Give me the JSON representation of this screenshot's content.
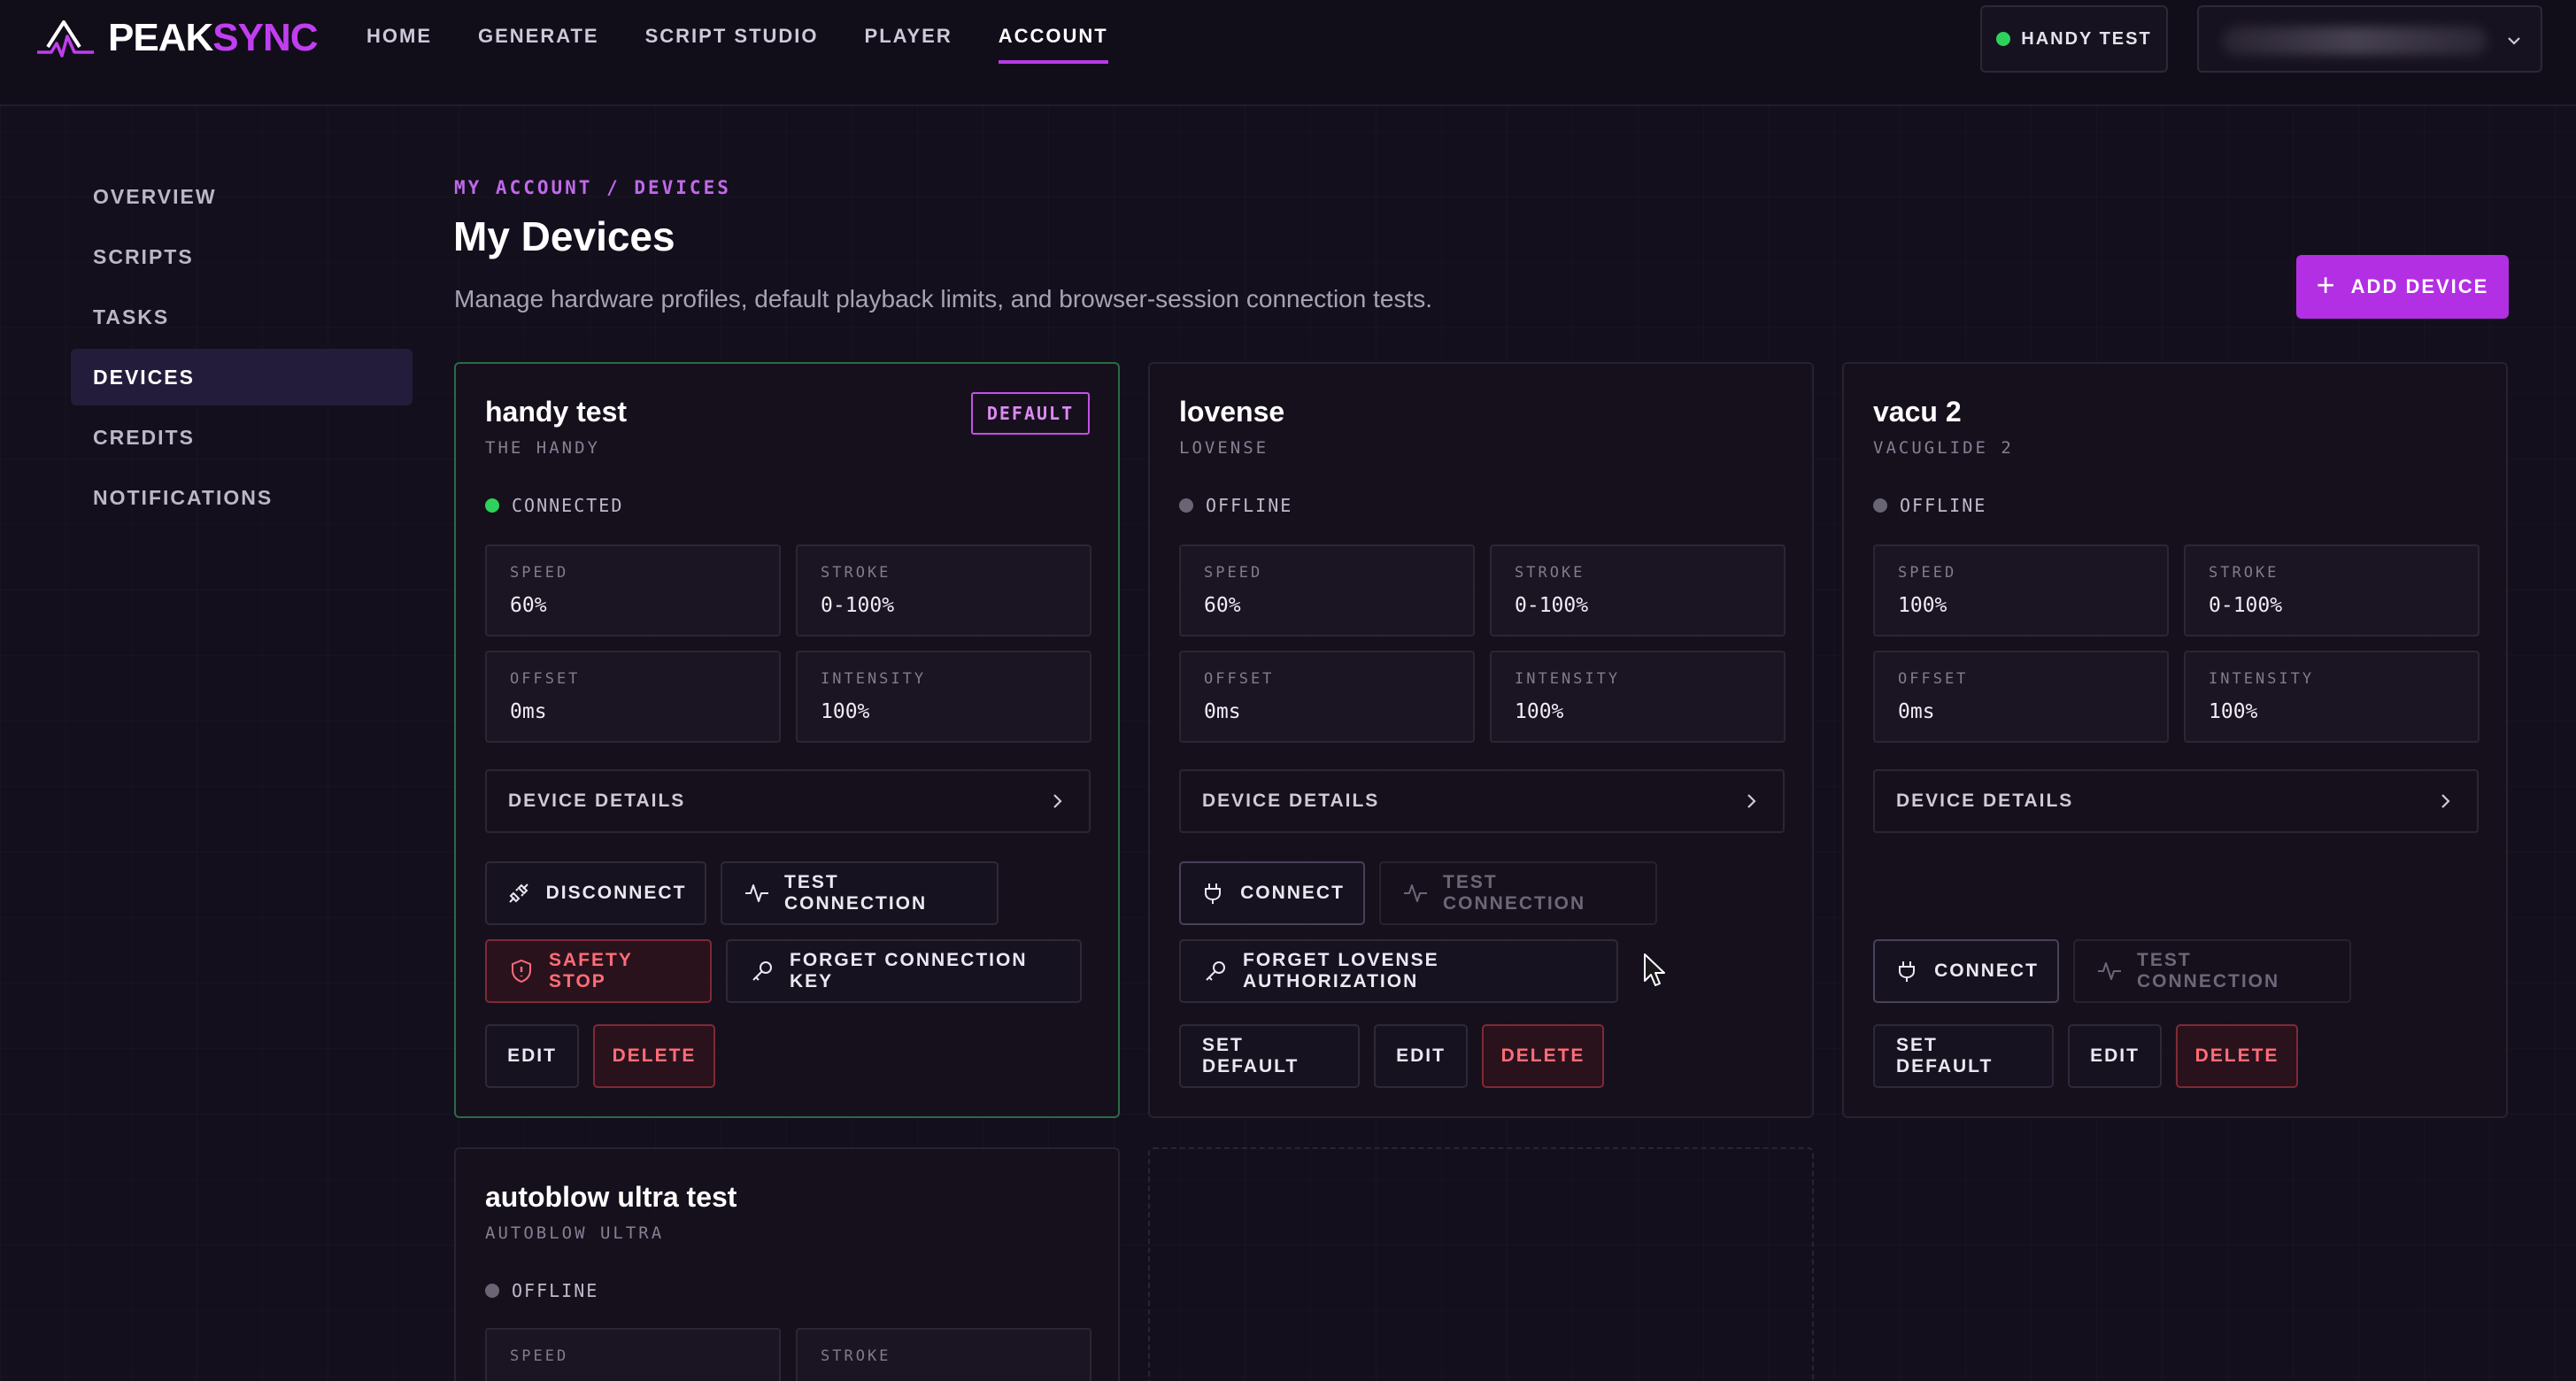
{
  "brand": {
    "peak": "PEAK",
    "sync": "SYNC"
  },
  "nav": [
    "HOME",
    "GENERATE",
    "SCRIPT STUDIO",
    "PLAYER",
    "ACCOUNT"
  ],
  "nav_active": "ACCOUNT",
  "active_device_pill": "HANDY TEST",
  "sidebar": [
    "OVERVIEW",
    "SCRIPTS",
    "TASKS",
    "DEVICES",
    "CREDITS",
    "NOTIFICATIONS"
  ],
  "sidebar_active": "DEVICES",
  "header": {
    "breadcrumb": "MY ACCOUNT / DEVICES",
    "title": "My Devices",
    "subtitle": "Manage hardware profiles, default playback limits, and browser-session connection tests.",
    "add_button": "ADD DEVICE"
  },
  "labels": {
    "speed": "SPEED",
    "stroke": "STROKE",
    "offset": "OFFSET",
    "intensity": "INTENSITY",
    "device_details": "DEVICE DETAILS",
    "default_badge": "DEFAULT",
    "connect": "CONNECT",
    "disconnect": "DISCONNECT",
    "test_connection": "TEST CONNECTION",
    "safety_stop": "SAFETY STOP",
    "forget_key": "FORGET CONNECTION KEY",
    "forget_lovense": "FORGET LOVENSE AUTHORIZATION",
    "set_default": "SET DEFAULT",
    "edit": "EDIT",
    "delete": "DELETE"
  },
  "devices": [
    {
      "name": "handy test",
      "model": "THE HANDY",
      "status": "CONNECTED",
      "is_default": true,
      "speed": "60%",
      "stroke": "0-100%",
      "offset": "0ms",
      "intensity": "100%"
    },
    {
      "name": "lovense",
      "model": "LOVENSE",
      "status": "OFFLINE",
      "is_default": false,
      "speed": "60%",
      "stroke": "0-100%",
      "offset": "0ms",
      "intensity": "100%"
    },
    {
      "name": "vacu 2",
      "model": "VACUGLIDE 2",
      "status": "OFFLINE",
      "is_default": false,
      "speed": "100%",
      "stroke": "0-100%",
      "offset": "0ms",
      "intensity": "100%"
    },
    {
      "name": "autoblow ultra test",
      "model": "AUTOBLOW ULTRA",
      "status": "OFFLINE",
      "is_default": false,
      "speed": "",
      "stroke": ""
    }
  ],
  "colors": {
    "accent": "#b32fe3",
    "connected": "#2ed15c",
    "danger": "#ff6d78",
    "default_border": "#2a6b45"
  },
  "icons": [
    "logo-mountain-icon",
    "chevron-down-icon",
    "plus-icon",
    "chevron-right-icon",
    "unplug-icon",
    "activity-icon",
    "shield-alert-icon",
    "key-icon",
    "plug-icon",
    "mouse-cursor-icon"
  ]
}
